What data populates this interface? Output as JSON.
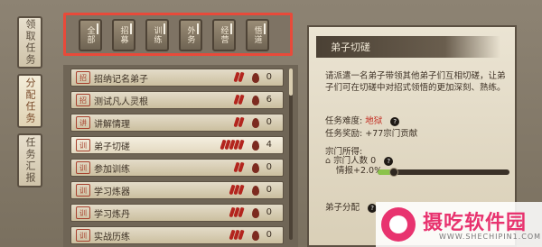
{
  "sidebar": {
    "tabs": [
      {
        "label": "领取任务",
        "active": false
      },
      {
        "label": "分配任务",
        "active": true
      },
      {
        "label": "任务汇报",
        "active": false
      }
    ]
  },
  "filters": {
    "buttons": [
      "全部",
      "招募",
      "训练",
      "外务",
      "经营",
      "悟道"
    ]
  },
  "task_list": {
    "rows": [
      {
        "seal": "招",
        "title": "招纳记名弟子",
        "difficulty": 2,
        "count": "0"
      },
      {
        "seal": "招",
        "title": "测试凡人灵根",
        "difficulty": 2,
        "count": "6"
      },
      {
        "seal": "讲",
        "title": "讲解情理",
        "difficulty": 2,
        "count": "0"
      },
      {
        "seal": "训",
        "title": "弟子切磋",
        "difficulty": 5,
        "count": "4",
        "selected": true
      },
      {
        "seal": "训",
        "title": "参加训练",
        "difficulty": 2,
        "count": "0"
      },
      {
        "seal": "训",
        "title": "学习炼器",
        "difficulty": 3,
        "count": "0"
      },
      {
        "seal": "训",
        "title": "学习炼丹",
        "difficulty": 3,
        "count": "0"
      },
      {
        "seal": "训",
        "title": "实战历练",
        "difficulty": 3,
        "count": "0"
      }
    ],
    "scroll_position": 0.0
  },
  "detail": {
    "title": "弟子切磋",
    "description": "请派遣一名弟子带领其他弟子们互相切磋，让弟子们可在切磋中对招式领悟的更加深刻、熟练。",
    "difficulty_label": "任务难度:",
    "difficulty_value": "地狱",
    "reward_label": "任务奖励:",
    "reward_value": "+77宗门贡献",
    "sect_label": "宗门所得:",
    "people_label": "宗门人数",
    "people_value": "0",
    "intel_label": "情报+2.0%",
    "progress": 0.12,
    "assign_label": "弟子分配"
  },
  "watermark": {
    "text": "摄吃软件园",
    "url": "WWW.SHECHIPIN1.COM"
  },
  "colors": {
    "highlight_border": "#e84a3a",
    "danger_text": "#c22a1f",
    "progress_fill": "#8bc34a"
  }
}
